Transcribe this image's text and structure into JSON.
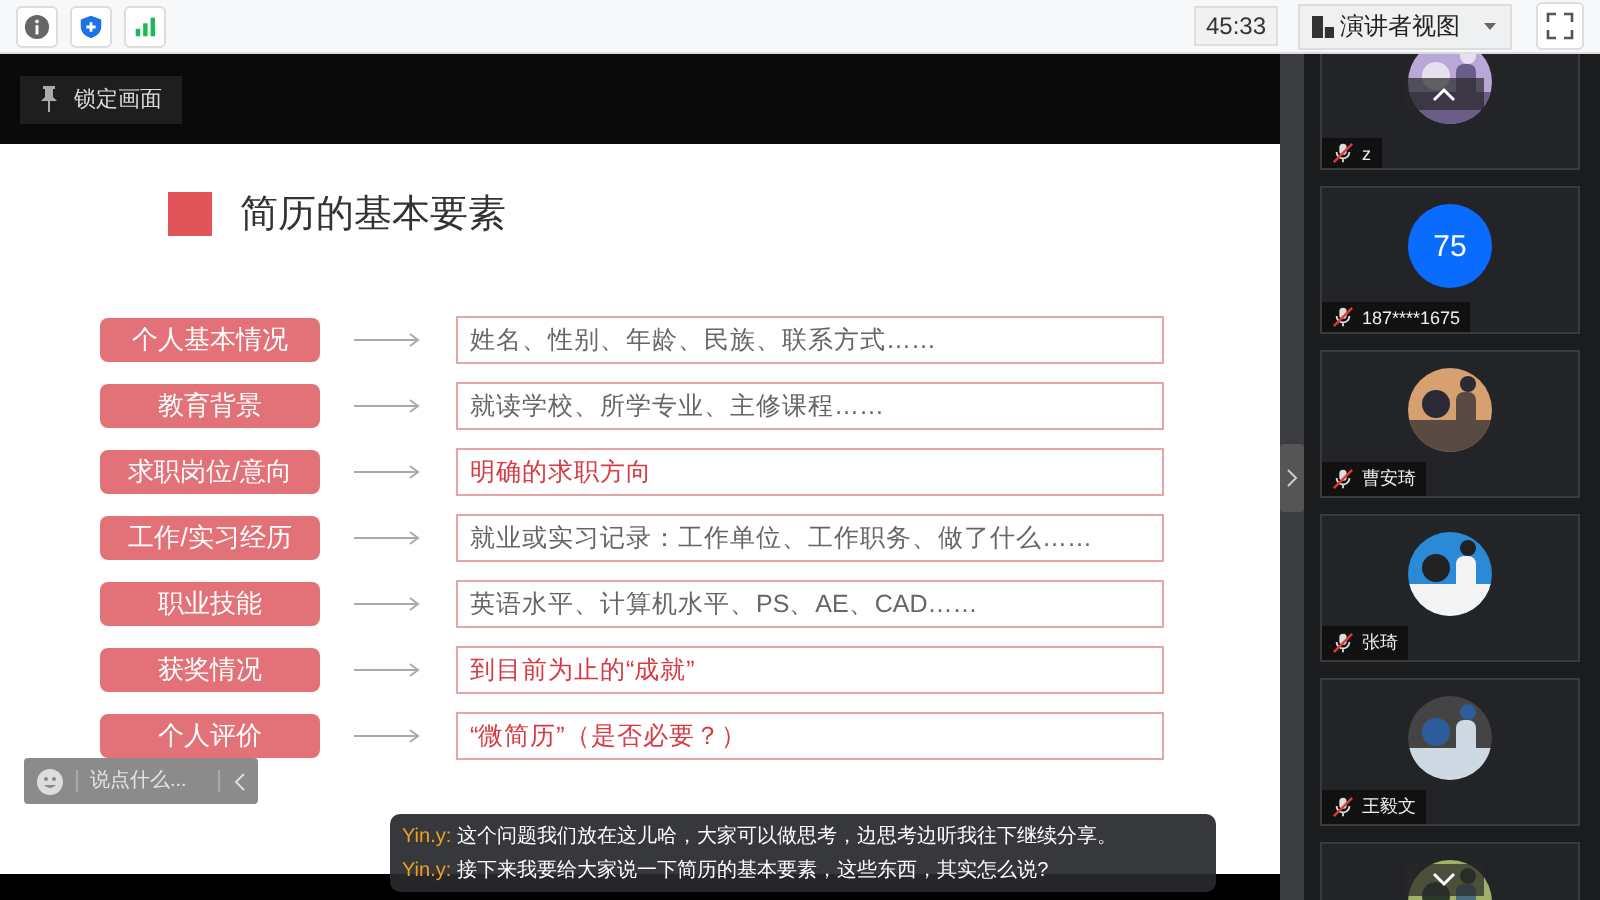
{
  "toolbar": {
    "timer": "45:33",
    "view_button": "演讲者视图"
  },
  "stage": {
    "lock_button": "锁定画面",
    "slide": {
      "title": "简历的基本要素",
      "rows": [
        {
          "label": "个人基本情况",
          "detail": "姓名、性别、年龄、民族、联系方式……",
          "highlighted": false
        },
        {
          "label": "教育背景",
          "detail": "就读学校、所学专业、主修课程……",
          "highlighted": false
        },
        {
          "label": "求职岗位/意向",
          "detail": "明确的求职方向",
          "highlighted": true
        },
        {
          "label": "工作/实习经历",
          "detail": "就业或实习记录：工作单位、工作职务、做了什么……",
          "highlighted": false
        },
        {
          "label": "职业技能",
          "detail": "英语水平、计算机水平、PS、AE、CAD……",
          "highlighted": false
        },
        {
          "label": "获奖情况",
          "detail": "到目前为止的“成就”",
          "highlighted": true
        },
        {
          "label": "个人评价",
          "detail": "“微简历”（是否必要？）",
          "highlighted": true
        }
      ]
    },
    "chat_input": {
      "placeholder": "说点什么..."
    },
    "subtitles": [
      {
        "speaker": "Yin.y:",
        "text": "这个问题我们放在这儿哈，大家可以做思考，边思考边听我往下继续分享。"
      },
      {
        "speaker": "Yin.y:",
        "text": "接下来我要给大家说一下简历的基本要素，这些东西，其实怎么说?"
      }
    ]
  },
  "participants": [
    {
      "name": "z",
      "kind": "picture",
      "muted": true
    },
    {
      "name": "187****1675",
      "kind": "initials",
      "initials": "75",
      "muted": true
    },
    {
      "name": "曹安琦",
      "kind": "picture",
      "muted": true
    },
    {
      "name": "张琦",
      "kind": "picture",
      "muted": true
    },
    {
      "name": "王毅文",
      "kind": "picture",
      "muted": true
    },
    {
      "kind": "picture"
    }
  ]
}
